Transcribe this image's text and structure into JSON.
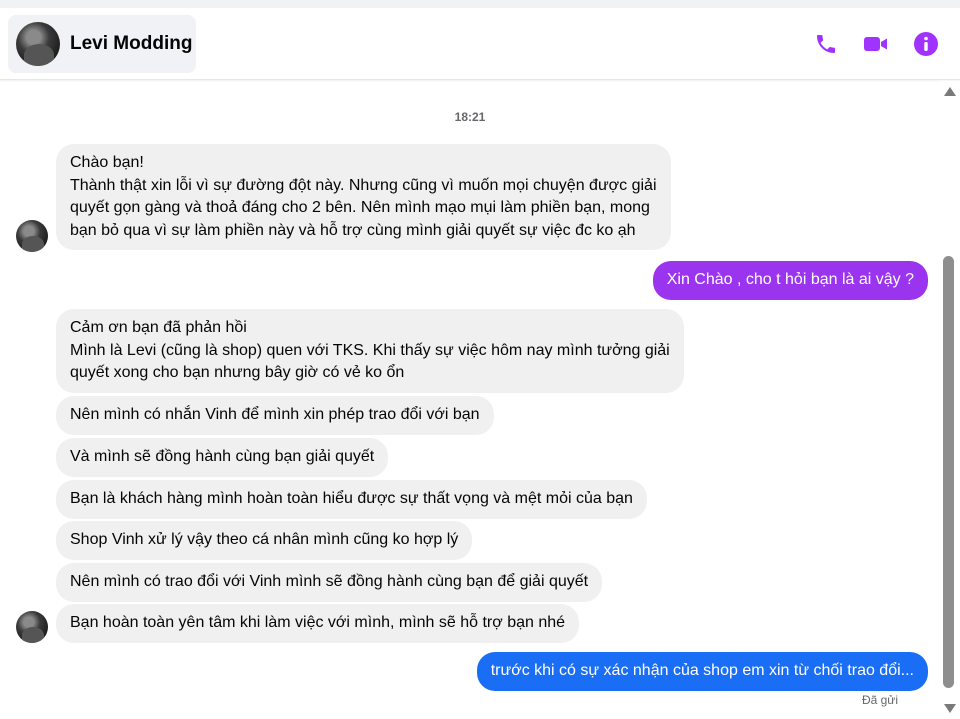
{
  "header": {
    "contact_name": "Levi Modding",
    "icons": [
      "phone-icon",
      "video-call-icon",
      "info-icon"
    ],
    "accent_color": "#a033ff"
  },
  "chat": {
    "timestamp": "18:21",
    "messages": [
      {
        "side": "in",
        "text": "Chào bạn!\nThành thật xin lỗi vì sự đường đột này. Nhưng cũng vì muốn mọi chuyện được giải\nquyết gọn gàng và thoả đáng cho 2 bên. Nên mình mạo mụi làm phiền bạn, mong\nbạn bỏ qua vì sự làm phiền này và hỗ trợ cùng mình giải quyết sự việc đc ko ạh"
      },
      {
        "side": "out",
        "text": "Xin Chào , cho t hỏi bạn là ai vậy ?",
        "color": "#9b34ef"
      },
      {
        "side": "in",
        "text": "Cảm ơn bạn đã phản hồi\nMình là Levi (cũng là shop) quen với TKS. Khi thấy sự việc hôm nay mình tưởng giải\nquyết xong cho bạn nhưng bây giờ có vẻ ko ổn"
      },
      {
        "side": "in",
        "text": "Nên mình có nhắn Vinh để mình xin phép trao đổi với bạn"
      },
      {
        "side": "in",
        "text": "Và mình sẽ đồng hành cùng bạn giải quyết"
      },
      {
        "side": "in",
        "text": "Bạn là khách hàng mình hoàn toàn hiểu được sự thất vọng và mệt mỏi của bạn"
      },
      {
        "side": "in",
        "text": "Shop Vinh xử lý vậy theo cá nhân mình cũng ko hợp lý"
      },
      {
        "side": "in",
        "text": "Nên mình có trao đổi với Vinh mình sẽ đồng hành cùng bạn để giải quyết"
      },
      {
        "side": "in",
        "text": "Bạn hoàn toàn yên tâm khi làm việc với mình, mình sẽ hỗ trợ bạn nhé"
      },
      {
        "side": "out",
        "text": "trước khi có sự xác nhận của shop em xin từ chối trao đổi...",
        "color": "#1a6ef5"
      }
    ],
    "status": "Đã gửi"
  }
}
